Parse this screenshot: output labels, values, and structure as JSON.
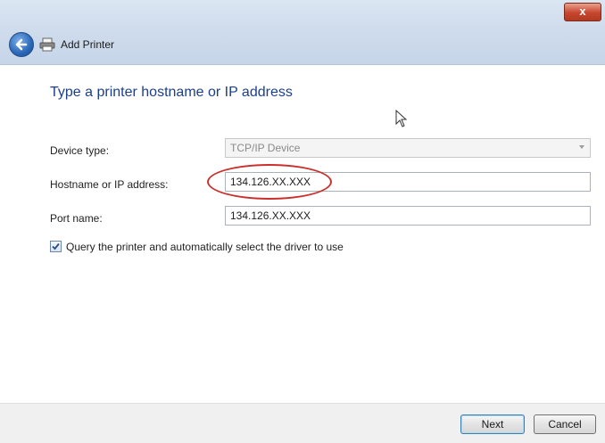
{
  "window": {
    "title": "Add Printer",
    "close_glyph": "x"
  },
  "page": {
    "heading": "Type a printer hostname or IP address"
  },
  "form": {
    "device_type": {
      "label": "Device type:",
      "value": "TCP/IP Device"
    },
    "hostname": {
      "label": "Hostname or IP address:",
      "value": "134.126.XX.XXX"
    },
    "port_name": {
      "label": "Port name:",
      "value": "134.126.XX.XXX"
    },
    "query_checkbox": {
      "label": "Query the printer and automatically select the driver to use",
      "checked": true
    }
  },
  "buttons": {
    "next": "Next",
    "cancel": "Cancel"
  },
  "icons": {
    "back": "back-arrow-icon",
    "printer": "printer-icon",
    "cursor": "mouse-cursor-icon"
  },
  "colors": {
    "heading": "#1c3f8a",
    "highlight": "#c9302c"
  }
}
